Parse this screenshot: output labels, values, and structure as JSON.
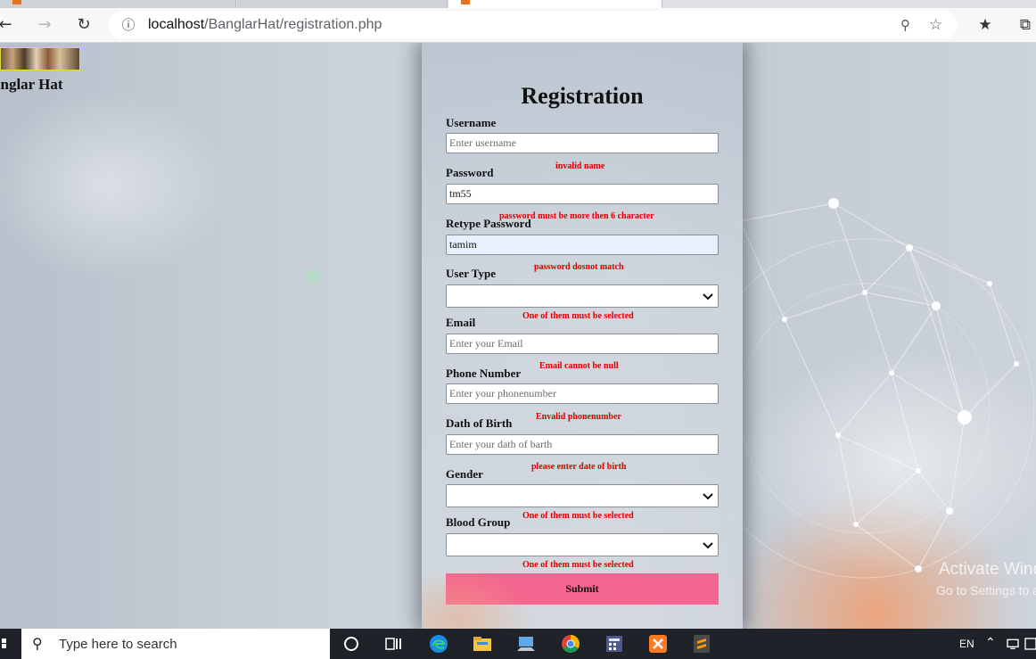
{
  "browser": {
    "address_host": "localhost",
    "address_path": "/BanglarHat/registration.php",
    "back_icon": "arrow-left-icon",
    "forward_icon": "arrow-right-icon",
    "refresh_icon": "refresh-icon"
  },
  "site": {
    "brand": "anglar Hat"
  },
  "form": {
    "title": "Registration",
    "username_label": "Username",
    "username_placeholder": "Enter username",
    "username_error": "invalid name",
    "password_label": "Password",
    "password_value": "tm55",
    "password_error": "password must be more then 6 character",
    "retype_label": "Retype Password",
    "retype_value": "tamim",
    "retype_error": "password dosnot match",
    "usertype_label": "User Type",
    "usertype_error": "One of them must be selected",
    "email_label": "Email",
    "email_placeholder": "Enter your Email",
    "email_error": "Email cannot be null",
    "phone_label": "Phone Number",
    "phone_placeholder": "Enter your phonenumber",
    "phone_error": "Envalid phonenumber",
    "dob_label": "Dath of Birth",
    "dob_placeholder": "Enter your dath of barth",
    "dob_error": "please enter date of birth",
    "gender_label": "Gender",
    "gender_error": "One of them must be selected",
    "blood_label": "Blood Group",
    "blood_error": "One of them must be selected",
    "submit_label": "Submit"
  },
  "watermark": {
    "line1": "Activate Windows",
    "line2": "Go to Settings to activate Windows."
  },
  "taskbar": {
    "search_placeholder": "Type here to search",
    "language": "EN"
  },
  "colors": {
    "error": "#e00000",
    "submit": "#f4668f",
    "autofill": "#e8f0fe"
  }
}
